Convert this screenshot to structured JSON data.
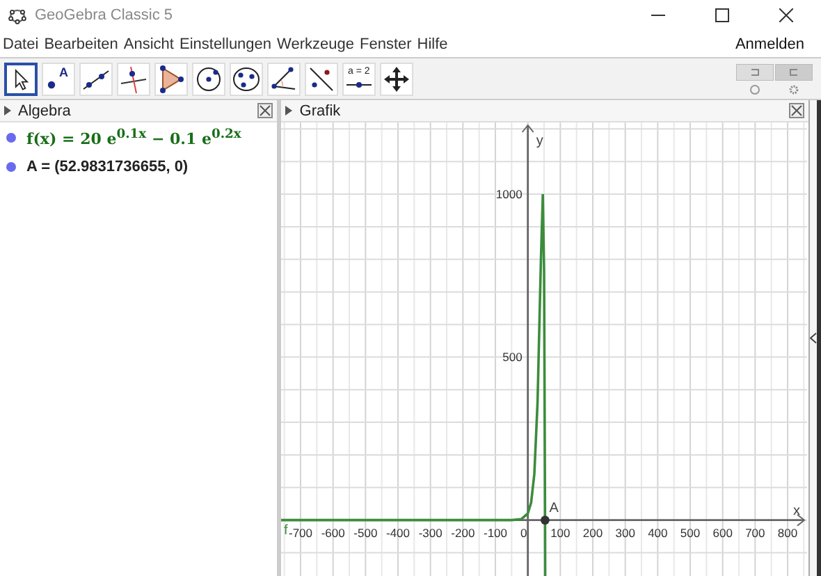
{
  "window": {
    "title": "GeoGebra Classic 5"
  },
  "menu": {
    "items": [
      "Datei",
      "Bearbeiten",
      "Ansicht",
      "Einstellungen",
      "Werkzeuge",
      "Fenster",
      "Hilfe"
    ],
    "sign_in": "Anmelden"
  },
  "tools": [
    {
      "kind": "move",
      "selected": true
    },
    {
      "kind": "point",
      "label": "A",
      "selected": false
    },
    {
      "kind": "line",
      "selected": false
    },
    {
      "kind": "perpendicular",
      "selected": false
    },
    {
      "kind": "polygon",
      "selected": false
    },
    {
      "kind": "circle",
      "selected": false
    },
    {
      "kind": "conic",
      "selected": false
    },
    {
      "kind": "angle",
      "selected": false
    },
    {
      "kind": "reflect",
      "selected": false
    },
    {
      "kind": "slider",
      "label": "a = 2",
      "selected": false
    },
    {
      "kind": "move-view",
      "selected": false
    }
  ],
  "algebra": {
    "title": "Algebra",
    "items": [
      {
        "kind": "function",
        "text": "f(x) = 20 e$^{0.1x}$ − 0.1 e$^{0.2x}$"
      },
      {
        "kind": "point",
        "text": "A = (52.9831736655, 0)"
      }
    ]
  },
  "graphics": {
    "title": "Grafik",
    "chart_data": {
      "type": "line",
      "xlabel": "x",
      "ylabel": "y",
      "x": [
        -760,
        -100,
        -50,
        -20,
        0,
        10,
        20,
        30,
        40,
        46,
        50,
        53,
        53.4
      ],
      "series": [
        {
          "name": "f",
          "color": "#3c8c3c",
          "values": [
            0,
            0,
            0,
            3,
            20,
            54,
            142,
            361,
            794,
            1000,
            766,
            -7,
            -178
          ]
        }
      ],
      "grid": true,
      "xlim": [
        -760,
        860
      ],
      "ylim": [
        -180,
        1220
      ],
      "xticks": [
        -700,
        -600,
        -500,
        -400,
        -300,
        -200,
        -100,
        0,
        100,
        200,
        300,
        400,
        500,
        600,
        700,
        800
      ],
      "yticks": [
        500,
        1000
      ],
      "annotations": [
        {
          "text": "A",
          "x": 52.98,
          "y": 0
        }
      ]
    }
  }
}
